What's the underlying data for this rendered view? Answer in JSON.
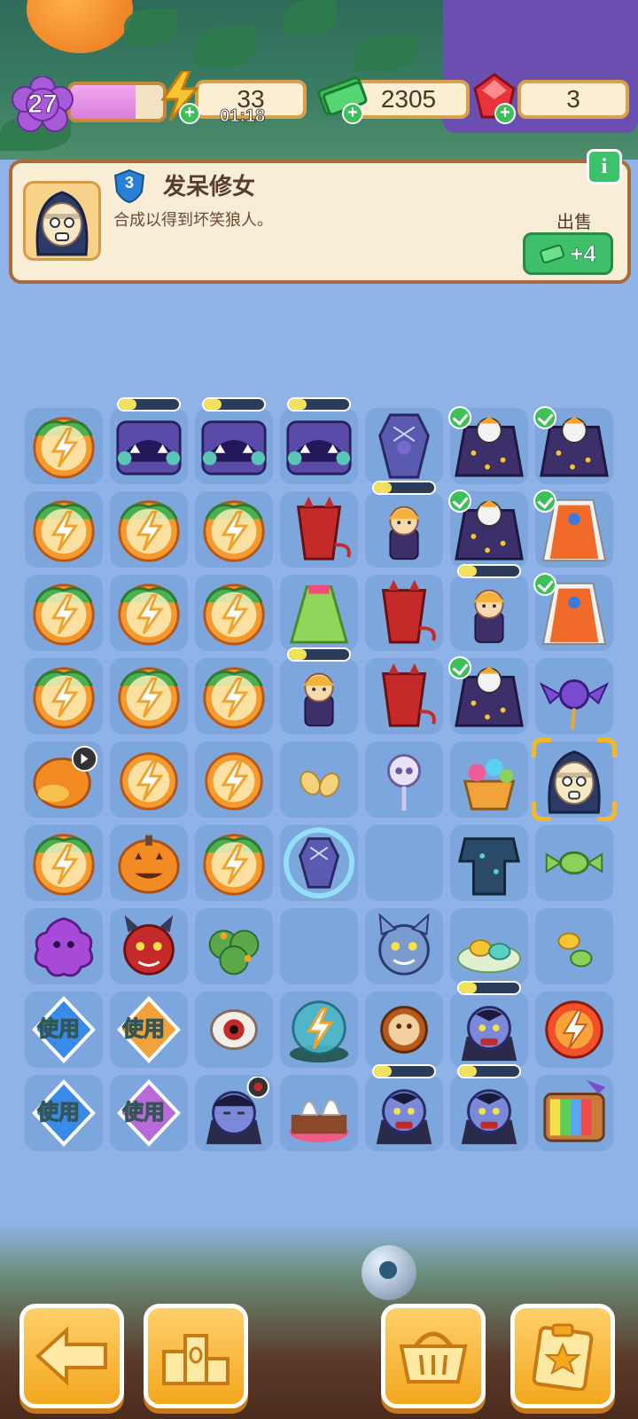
{
  "hud": {
    "level": "27",
    "xp_progress": 0.7,
    "energy": "33",
    "energy_timer": "01:18",
    "cash": "2305",
    "gems": "3"
  },
  "info_panel": {
    "item_level": "3",
    "title": "发呆修女",
    "description": "合成以得到坏笑狼人。",
    "info_button": "i",
    "sell_label": "出售",
    "sell_value": "+4"
  },
  "board": {
    "use_label": "使用"
  },
  "colors": {
    "background": "#8fb3e6",
    "panel": "#f8eed6",
    "accent_green": "#3fbf6a",
    "button_orange": "#f3a71e"
  }
}
